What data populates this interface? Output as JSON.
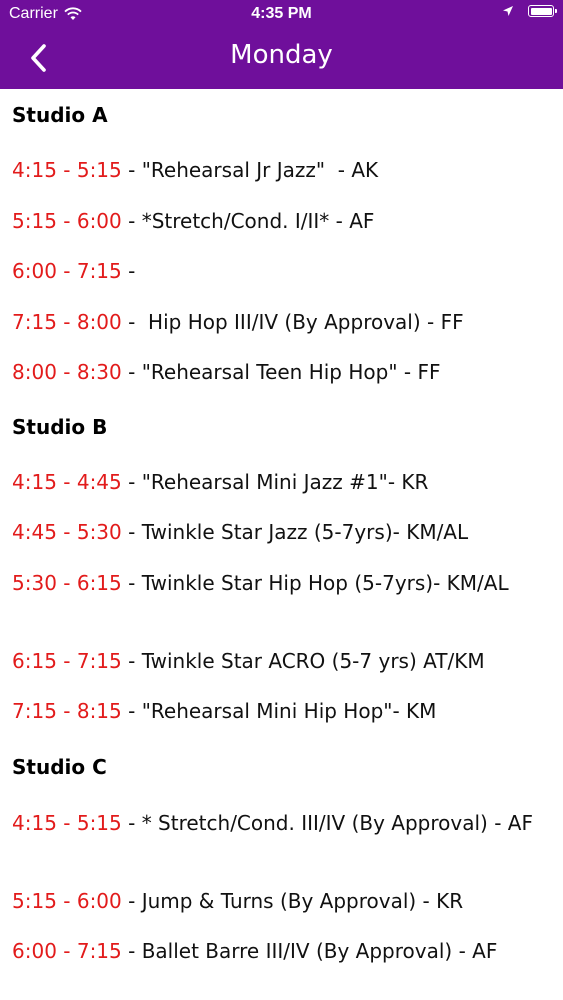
{
  "status_bar": {
    "carrier": "Carrier",
    "time": "4:35 PM",
    "battery_level": 1.0
  },
  "nav": {
    "title": "Monday"
  },
  "studios": [
    {
      "name": "Studio A",
      "classes": [
        {
          "time": "4:15 - 5:15",
          "desc": " - \"Rehearsal Jr Jazz\"  - AK"
        },
        {
          "time": "5:15 - 6:00",
          "desc": " - *Stretch/Cond. I/II* - AF"
        },
        {
          "time": "6:00 - 7:15",
          "desc": " -"
        },
        {
          "time": "7:15 - 8:00",
          "desc": " -  Hip Hop III/IV (By Approval) - FF"
        },
        {
          "time": "8:00 - 8:30",
          "desc": " - \"Rehearsal Teen Hip Hop\" - FF"
        }
      ]
    },
    {
      "name": "Studio B",
      "classes": [
        {
          "time": "4:15 - 4:45",
          "desc": " - \"Rehearsal Mini Jazz #1\"- KR"
        },
        {
          "time": "4:45 - 5:30",
          "desc": " - Twinkle Star Jazz (5-7yrs)- KM/AL"
        },
        {
          "time": "5:30 - 6:15",
          "desc": " - Twinkle Star Hip Hop (5-7yrs)- KM/AL"
        },
        {
          "time": "6:15 - 7:15",
          "desc": " - Twinkle Star ACRO (5-7 yrs) AT/KM"
        },
        {
          "time": "7:15 - 8:15",
          "desc": " - \"Rehearsal Mini Hip Hop\"- KM"
        }
      ]
    },
    {
      "name": "Studio C",
      "classes": [
        {
          "time": "4:15 - 5:15",
          "desc": " - * Stretch/Cond. III/IV (By Approval) - AF"
        },
        {
          "time": "5:15 - 6:00",
          "desc": " - Jump & Turns (By Approval) - KR"
        },
        {
          "time": "6:00 - 7:15",
          "desc": " - Ballet Barre III/IV (By Approval) - AF"
        }
      ]
    }
  ],
  "colors": {
    "header_bg": "#6f0f9b",
    "time_text": "#e21b1b"
  }
}
